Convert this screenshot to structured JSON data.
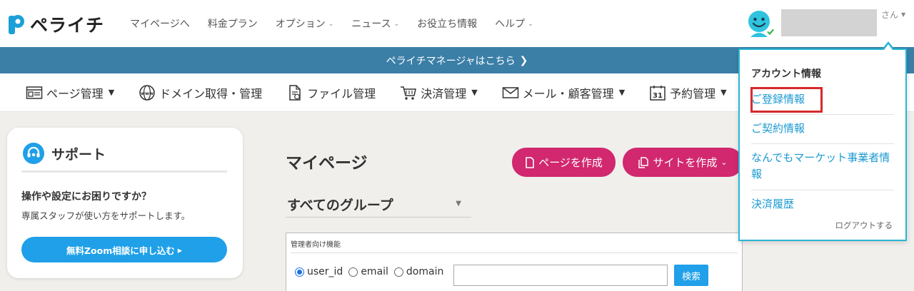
{
  "header": {
    "logo_text": "ペライチ",
    "nav": [
      {
        "label": "マイページへ",
        "has_caret": false
      },
      {
        "label": "料金プラン",
        "has_caret": false
      },
      {
        "label": "オプション",
        "has_caret": true
      },
      {
        "label": "ニュース",
        "has_caret": true
      },
      {
        "label": "お役立ち情報",
        "has_caret": false
      },
      {
        "label": "ヘルプ",
        "has_caret": true
      }
    ],
    "user_suffix": "さん"
  },
  "banner": {
    "text": "ペライチマネージャはこちら",
    "arrow": "❯"
  },
  "toolnav": [
    {
      "label": "ページ管理",
      "icon": "page-icon",
      "has_caret": true
    },
    {
      "label": "ドメイン取得・管理",
      "icon": "www-globe-icon",
      "has_caret": false
    },
    {
      "label": "ファイル管理",
      "icon": "file-icon",
      "has_caret": false
    },
    {
      "label": "決済管理",
      "icon": "cart-icon",
      "has_caret": true
    },
    {
      "label": "メール・顧客管理",
      "icon": "mail-icon",
      "has_caret": true
    },
    {
      "label": "予約管理",
      "icon": "calendar-icon",
      "has_caret": true,
      "calendar_day": "31"
    }
  ],
  "support": {
    "title": "サポート",
    "question": "操作や設定にお困りですか？",
    "description": "専属スタッフが使い方をサポートします。",
    "button": "無料Zoom相談に申し込む",
    "button_arrow": "▸"
  },
  "main": {
    "title": "マイページ",
    "create_page_button": "ページを作成",
    "create_site_button": "サイトを作成",
    "group_select": "すべてのグループ"
  },
  "admin": {
    "title": "管理者向け機能",
    "radios": [
      {
        "label": "user_id",
        "checked": true
      },
      {
        "label": "email",
        "checked": false
      },
      {
        "label": "domain",
        "checked": false
      }
    ],
    "search_value": "",
    "search_button": "検索"
  },
  "account_menu": {
    "heading": "アカウント情報",
    "items": [
      "ご登録情報",
      "ご契約情報",
      "なんでもマーケット事業者情報",
      "決済履歴"
    ],
    "logout": "ログアウトする",
    "highlighted_item": "ご登録情報"
  },
  "colors": {
    "brand_blue": "#3b7fa7",
    "pink": "#d1286f",
    "link": "#1c9ad1",
    "zoom_button": "#1fa0e8",
    "dropdown_border": "#29b6d5",
    "highlight_red": "#d62a2a"
  }
}
